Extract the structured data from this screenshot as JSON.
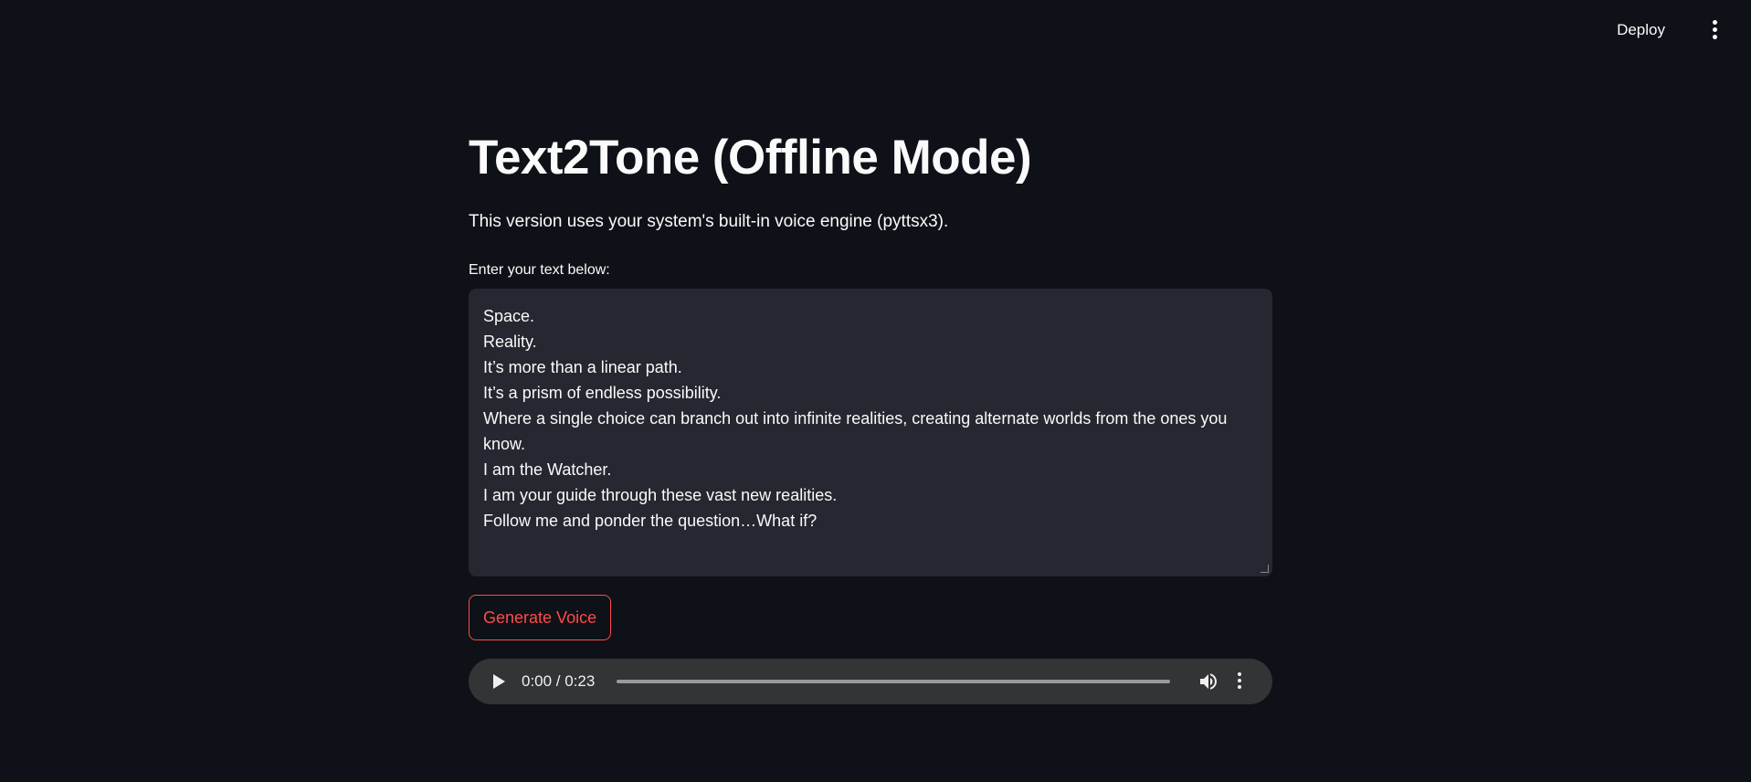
{
  "header": {
    "deploy_label": "Deploy",
    "menu_icon": "vertical-ellipsis-icon"
  },
  "main": {
    "title": "Text2Tone (Offline Mode)",
    "subtitle": "This version uses your system's built-in voice engine (pyttsx3).",
    "input_label": "Enter your text below:",
    "text_lines": [
      "Space.",
      "Reality.",
      "It’s more than a linear path.",
      "It’s a prism of endless possibility.",
      "Where a single choice can branch out into infinite realities, creating alternate worlds from the ones you know.",
      "I am the Watcher.",
      "I am your guide through these vast new realities.",
      "Follow me and ponder the question…What if?"
    ],
    "generate_button_label": "Generate Voice"
  },
  "audio": {
    "time": "0:00 / 0:23",
    "progress": 0,
    "play_icon": "play-icon",
    "volume_icon": "volume-icon",
    "menu_icon": "vertical-ellipsis-icon"
  },
  "colors": {
    "background": "#0e1117",
    "input_background": "#262730",
    "accent": "#ff4b4b",
    "player_background": "#333436"
  }
}
